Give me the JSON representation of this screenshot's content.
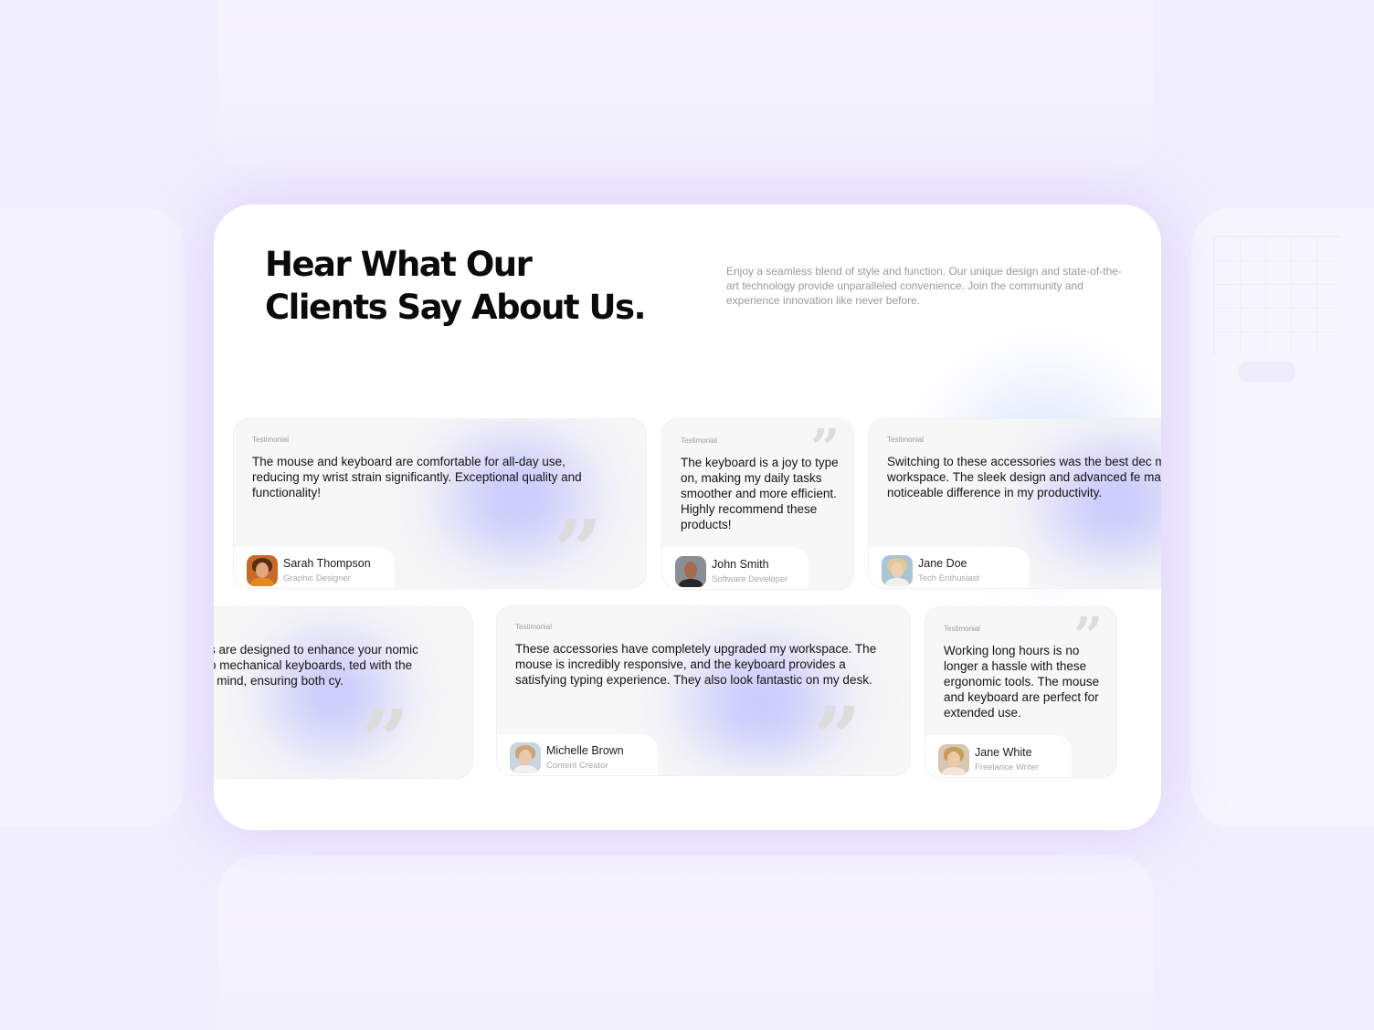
{
  "heading": {
    "line1": "Hear What Our",
    "line2": "Clients Say About Us."
  },
  "subtitle": "Enjoy a seamless blend of style and function. Our unique design and state-of-the-art technology provide unparalleled convenience. Join the community and experience innovation like never before.",
  "testimonials": [
    {
      "tag": "Testimonial",
      "text": "The mouse and keyboard are comfortable for all-day use, reducing my wrist strain significantly. Exceptional quality and functionality!",
      "name": "Sarah Thompson",
      "role": "Graphic Designer"
    },
    {
      "tag": "Testimonial",
      "text": "The keyboard is a joy to type on, making my daily tasks smoother and more efficient. Highly recommend these products!",
      "name": "John Smith",
      "role": "Software Developer"
    },
    {
      "tag": "Testimonial",
      "text": "Switching to these accessories was the best dec my workspace. The sleek design and advanced fe made a noticeable difference in my productivity.",
      "name": "Jane Doe",
      "role": "Tech Enthusiast"
    },
    {
      "tag": "",
      "text": "ssories are designed to enhance your nomic mice to mechanical keyboards, ted with the user in mind, ensuring both cy."
    },
    {
      "tag": "Testimonial",
      "text": "These accessories have completely upgraded my workspace. The mouse is incredibly responsive, and the keyboard provides a satisfying typing experience. They also look fantastic on my desk.",
      "name": "Michelle  Brown",
      "role": "Content Creator"
    },
    {
      "tag": "Testimonial",
      "text": "Working long hours is no longer a hassle with these ergonomic tools. The mouse and keyboard are perfect for extended use.",
      "name": "Jane White",
      "role": "Freelance Writer"
    }
  ],
  "icons": {
    "quote": "quote-icon"
  },
  "colors": {
    "page_background": "#f1eefd",
    "card_background": "#ffffff",
    "testimonial_background": "#f7f7f7",
    "accent_glow": "#a5aaff"
  }
}
